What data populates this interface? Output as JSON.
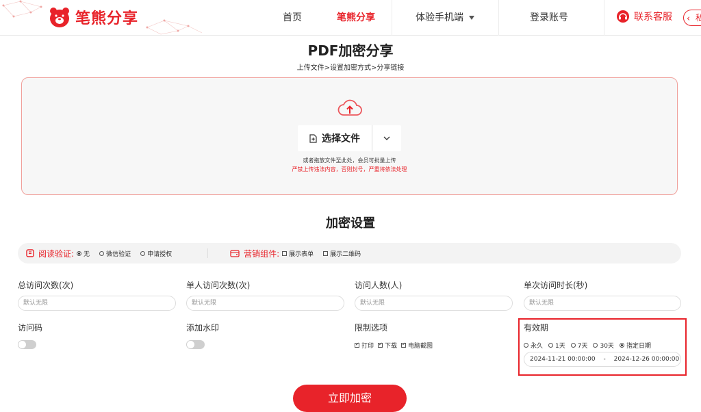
{
  "header": {
    "logo_text": "笔熊分享",
    "nav": [
      {
        "label": "首页"
      },
      {
        "label": "笔熊分享"
      },
      {
        "label": "体验手机端"
      },
      {
        "label": "登录账号"
      }
    ],
    "service_label": "联系客服",
    "private_tab_label": "私"
  },
  "page": {
    "title": "PDF加密分享",
    "steps": "上传文件>设置加密方式>分享链接"
  },
  "upload": {
    "choose_label": "选择文件",
    "hint": "或者拖放文件至此处，会员可批量上传",
    "warning": "严禁上传违法内容，否则封号，严重将依法处理"
  },
  "settings": {
    "title": "加密设置",
    "read_verify": {
      "label": "阅读验证:",
      "options": [
        "无",
        "微信验证",
        "申请授权"
      ],
      "selected": "无"
    },
    "marketing": {
      "label": "营销组件:",
      "options": [
        "展示表单",
        "展示二维码"
      ]
    },
    "fields": [
      {
        "label": "总访问次数(次)",
        "placeholder": "默认无限"
      },
      {
        "label": "单人访问次数(次)",
        "placeholder": "默认无限"
      },
      {
        "label": "访问人数(人)",
        "placeholder": "默认无限"
      },
      {
        "label": "单次访问时长(秒)",
        "placeholder": "默认无限"
      }
    ],
    "access_code_label": "访问码",
    "watermark_label": "添加水印",
    "limit": {
      "label": "限制选项",
      "options": [
        "打印",
        "下载",
        "电脑截图"
      ]
    },
    "validity": {
      "label": "有效期",
      "options": [
        "永久",
        "1天",
        "7天",
        "30天",
        "指定日期"
      ],
      "selected": "指定日期",
      "start": "2024-11-21 00:00:00",
      "separator": "-",
      "end": "2024-12-26 00:00:00"
    },
    "submit_label": "立即加密"
  },
  "colors": {
    "accent": "#e8232a"
  }
}
